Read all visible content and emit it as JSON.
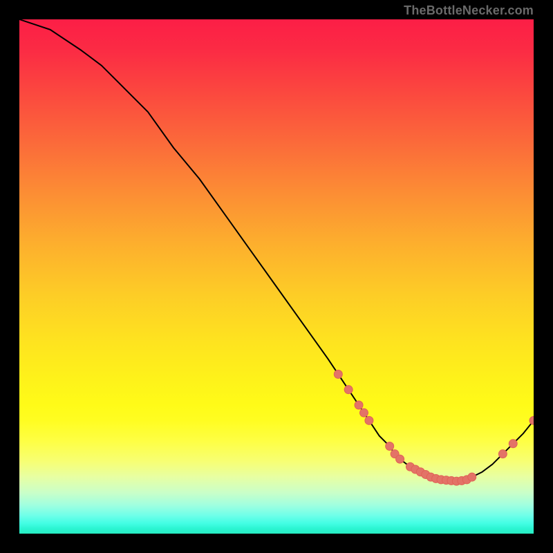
{
  "watermark": "TheBottleNecker.com",
  "colors": {
    "curve_stroke": "#000000",
    "point_fill": "#e37367",
    "point_stroke": "#e06156"
  },
  "chart_data": {
    "type": "line",
    "title": "",
    "xlabel": "",
    "ylabel": "",
    "xlim": [
      0,
      100
    ],
    "ylim": [
      0,
      100
    ],
    "x": [
      0,
      3,
      6,
      9,
      12,
      16,
      20,
      25,
      30,
      35,
      40,
      45,
      50,
      55,
      60,
      62,
      64,
      66,
      67,
      68,
      70,
      71,
      72,
      73,
      74,
      76,
      78,
      80,
      82,
      84,
      85,
      86,
      87,
      88,
      90,
      92,
      94,
      96,
      98,
      100
    ],
    "values": [
      100,
      99,
      98,
      96,
      94,
      91,
      87,
      82,
      75,
      69,
      62,
      55,
      48,
      41,
      34,
      31,
      28,
      25,
      23.5,
      22,
      19,
      18,
      17,
      15.5,
      14.5,
      13,
      12,
      11,
      10.5,
      10.3,
      10.2,
      10.3,
      10.5,
      11,
      12,
      13.5,
      15.5,
      17.5,
      19.5,
      22
    ],
    "highlight_points": [
      {
        "x": 62,
        "y": 31
      },
      {
        "x": 64,
        "y": 28
      },
      {
        "x": 66,
        "y": 25
      },
      {
        "x": 67,
        "y": 23.5
      },
      {
        "x": 68,
        "y": 22
      },
      {
        "x": 72,
        "y": 17
      },
      {
        "x": 73,
        "y": 15.5
      },
      {
        "x": 74,
        "y": 14.5
      },
      {
        "x": 76,
        "y": 13.0
      },
      {
        "x": 77,
        "y": 12.5
      },
      {
        "x": 78,
        "y": 12.0
      },
      {
        "x": 79,
        "y": 11.5
      },
      {
        "x": 80,
        "y": 11.0
      },
      {
        "x": 81,
        "y": 10.7
      },
      {
        "x": 82,
        "y": 10.5
      },
      {
        "x": 83,
        "y": 10.4
      },
      {
        "x": 84,
        "y": 10.3
      },
      {
        "x": 85,
        "y": 10.2
      },
      {
        "x": 86,
        "y": 10.3
      },
      {
        "x": 87,
        "y": 10.5
      },
      {
        "x": 88,
        "y": 11.0
      },
      {
        "x": 94,
        "y": 15.5
      },
      {
        "x": 96,
        "y": 17.5
      },
      {
        "x": 100,
        "y": 22
      }
    ]
  }
}
